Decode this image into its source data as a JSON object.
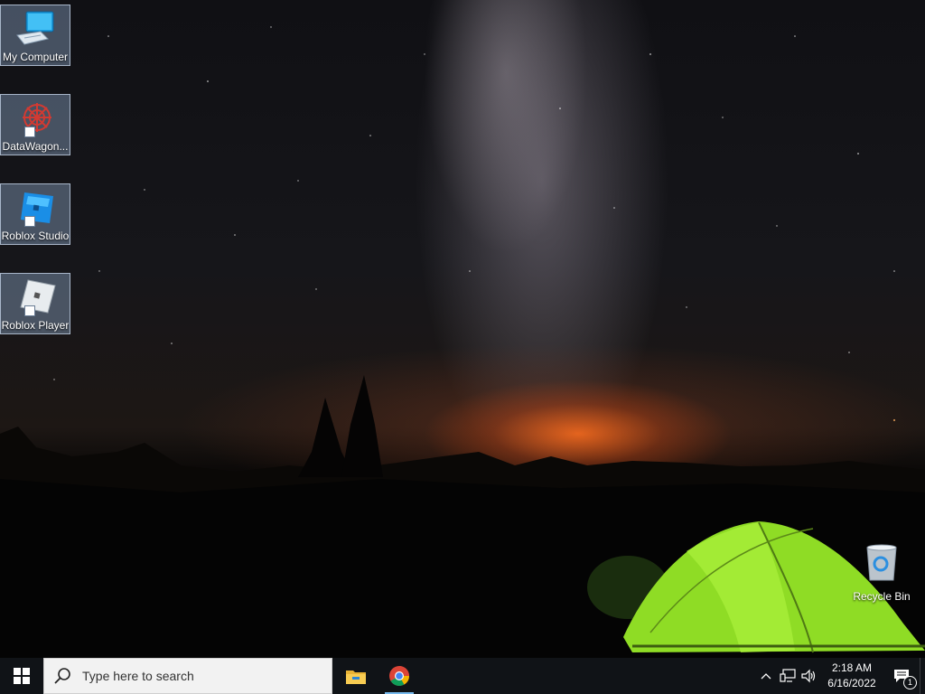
{
  "desktop": {
    "icons": [
      {
        "label": "My Computer",
        "icon": "computer-icon"
      },
      {
        "label": "DataWagon...",
        "icon": "datawagon-icon"
      },
      {
        "label": "Roblox Studio",
        "icon": "roblox-studio-icon"
      },
      {
        "label": "Roblox Player",
        "icon": "roblox-player-icon"
      }
    ],
    "recycle_bin": {
      "label": "Recycle Bin",
      "icon": "recycle-bin-icon"
    }
  },
  "taskbar": {
    "search_placeholder": "Type here to search",
    "pinned_apps": [
      {
        "name": "File Explorer",
        "icon": "folder-icon"
      },
      {
        "name": "Google Chrome",
        "icon": "chrome-icon",
        "active": true
      }
    ],
    "clock": {
      "time": "2:18 AM",
      "date": "6/16/2022"
    },
    "notifications_count": "1"
  },
  "colors": {
    "taskbar": "#101317",
    "accent": "#76b9ed",
    "tent": "#9be52a"
  }
}
